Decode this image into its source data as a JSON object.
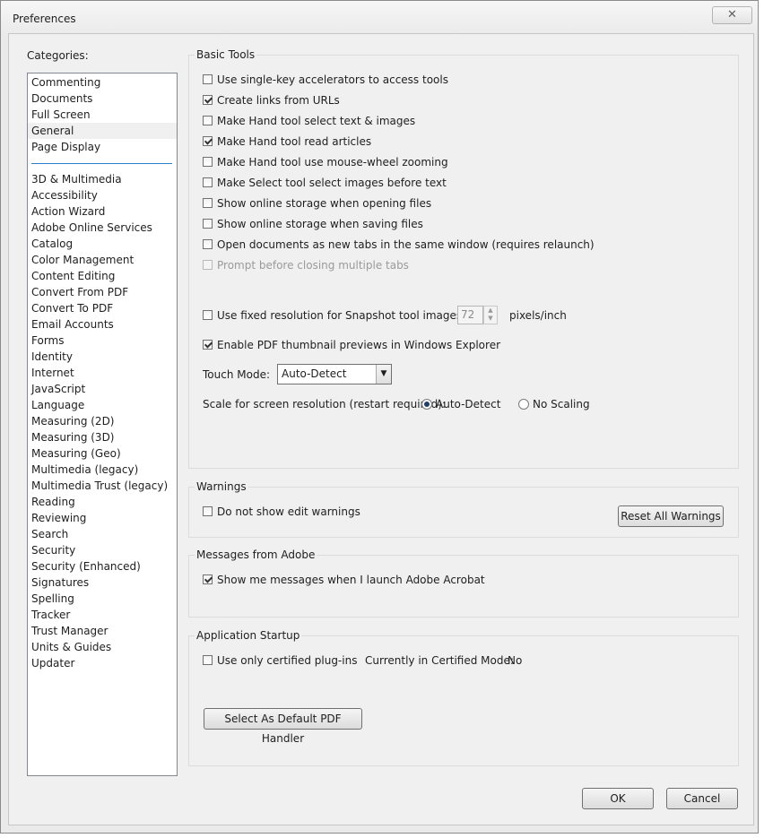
{
  "window": {
    "title": "Preferences",
    "close_glyph": "✕"
  },
  "categories": {
    "label": "Categories:",
    "top_items": [
      "Commenting",
      "Documents",
      "Full Screen",
      "General",
      "Page Display"
    ],
    "selected": "General",
    "items": [
      "3D & Multimedia",
      "Accessibility",
      "Action Wizard",
      "Adobe Online Services",
      "Catalog",
      "Color Management",
      "Content Editing",
      "Convert From PDF",
      "Convert To PDF",
      "Email Accounts",
      "Forms",
      "Identity",
      "Internet",
      "JavaScript",
      "Language",
      "Measuring (2D)",
      "Measuring (3D)",
      "Measuring (Geo)",
      "Multimedia (legacy)",
      "Multimedia Trust (legacy)",
      "Reading",
      "Reviewing",
      "Search",
      "Security",
      "Security (Enhanced)",
      "Signatures",
      "Spelling",
      "Tracker",
      "Trust Manager",
      "Units & Guides",
      "Updater"
    ]
  },
  "basic_tools": {
    "title": "Basic Tools",
    "options": [
      {
        "label": "Use single-key accelerators to access tools",
        "checked": false,
        "disabled": false
      },
      {
        "label": "Create links from URLs",
        "checked": true,
        "disabled": false
      },
      {
        "label": "Make Hand tool select text & images",
        "checked": false,
        "disabled": false
      },
      {
        "label": "Make Hand tool read articles",
        "checked": true,
        "disabled": false
      },
      {
        "label": "Make Hand tool use mouse-wheel zooming",
        "checked": false,
        "disabled": false
      },
      {
        "label": "Make Select tool select images before text",
        "checked": false,
        "disabled": false
      },
      {
        "label": "Show online storage when opening files",
        "checked": false,
        "disabled": false
      },
      {
        "label": "Show online storage when saving files",
        "checked": false,
        "disabled": false
      },
      {
        "label": "Open documents as new tabs in the same window (requires relaunch)",
        "checked": false,
        "disabled": false
      },
      {
        "label": "Prompt before closing multiple tabs",
        "checked": false,
        "disabled": true
      }
    ],
    "snapshot": {
      "label": "Use fixed resolution for Snapshot tool images:",
      "checked": false,
      "value": "72",
      "unit": "pixels/inch"
    },
    "thumbnail": {
      "label": "Enable PDF thumbnail previews in Windows Explorer",
      "checked": true
    },
    "touch_mode": {
      "label": "Touch Mode:",
      "value": "Auto-Detect",
      "arrow": "▼"
    },
    "scale": {
      "label": "Scale for screen resolution (restart required):",
      "options": [
        "Auto-Detect",
        "No Scaling"
      ],
      "selected": "Auto-Detect"
    }
  },
  "warnings": {
    "title": "Warnings",
    "option": {
      "label": "Do not show edit warnings",
      "checked": false
    },
    "reset_label": "Reset All Warnings"
  },
  "messages": {
    "title": "Messages from Adobe",
    "option": {
      "label": "Show me messages when I launch Adobe Acrobat",
      "checked": true
    }
  },
  "startup": {
    "title": "Application Startup",
    "option": {
      "label": "Use only certified plug-ins",
      "checked": false
    },
    "certified_label": "Currently in Certified Mode:",
    "certified_value": "No",
    "default_handler_label": "Select As Default PDF Handler"
  },
  "footer": {
    "ok_label": "OK",
    "cancel_label": "Cancel"
  }
}
